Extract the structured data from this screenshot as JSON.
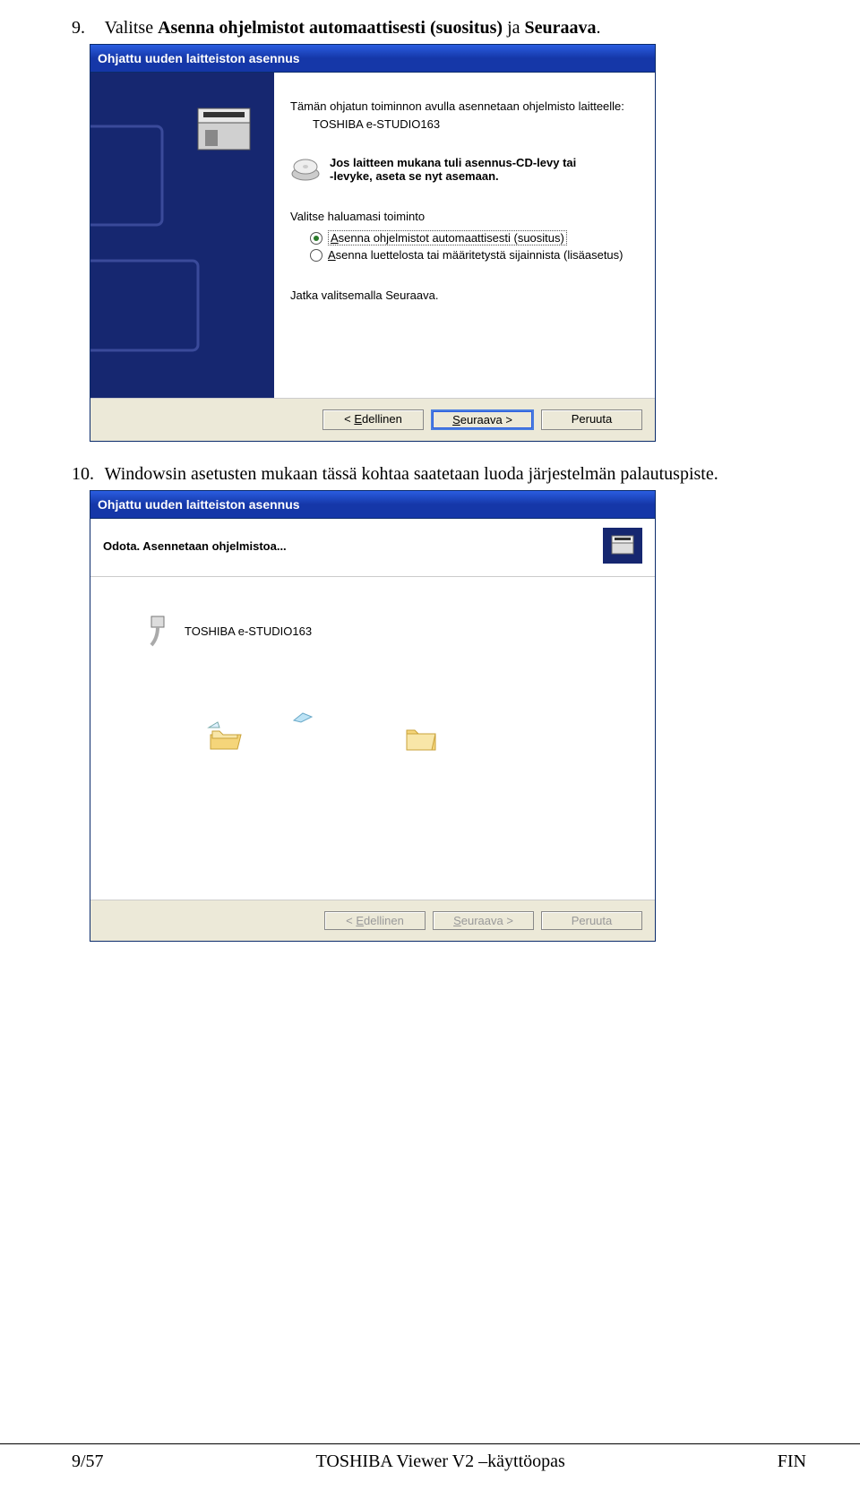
{
  "step9": {
    "num": "9.",
    "pre": "Valitse ",
    "bold1": "Asenna ohjelmistot automaattisesti (suositus)",
    "mid": " ja ",
    "bold2": "Seuraava",
    "post": "."
  },
  "dialog1": {
    "title": "Ohjattu uuden laitteiston asennus",
    "intro": "Tämän ohjatun toiminnon avulla asennetaan ohjelmisto laitteelle:",
    "device": "TOSHIBA e-STUDIO163",
    "cdline1": "Jos laitteen mukana tuli asennus-CD-levy tai",
    "cdline2": "-levyke, aseta se nyt asemaan.",
    "prompt": "Valitse haluamasi toiminto",
    "option1_pre": "A",
    "option1_rest": "senna ohjelmistot automaattisesti (suositus)",
    "option2_pre": "A",
    "option2_rest": "senna luettelosta tai määritetystä sijainnista (lisäasetus)",
    "continue": "Jatka valitsemalla Seuraava.",
    "back_pre": "< ",
    "back_u": "E",
    "back_rest": "dellinen",
    "next_u": "S",
    "next_rest": "euraava >",
    "cancel": "Peruuta"
  },
  "step10": {
    "num": "10.",
    "text": "Windowsin asetusten mukaan tässä kohtaa saatetaan luoda järjestelmän palautuspiste."
  },
  "dialog2": {
    "title": "Ohjattu uuden laitteiston asennus",
    "wait": "Odota. Asennetaan ohjelmistoa...",
    "device": "TOSHIBA e-STUDIO163",
    "back_pre": "< ",
    "back_u": "E",
    "back_rest": "dellinen",
    "next_u": "S",
    "next_rest": "euraava >",
    "cancel": "Peruuta"
  },
  "footer": {
    "left": "9/57",
    "center": "TOSHIBA Viewer V2 –käyttöopas",
    "right": "FIN"
  }
}
